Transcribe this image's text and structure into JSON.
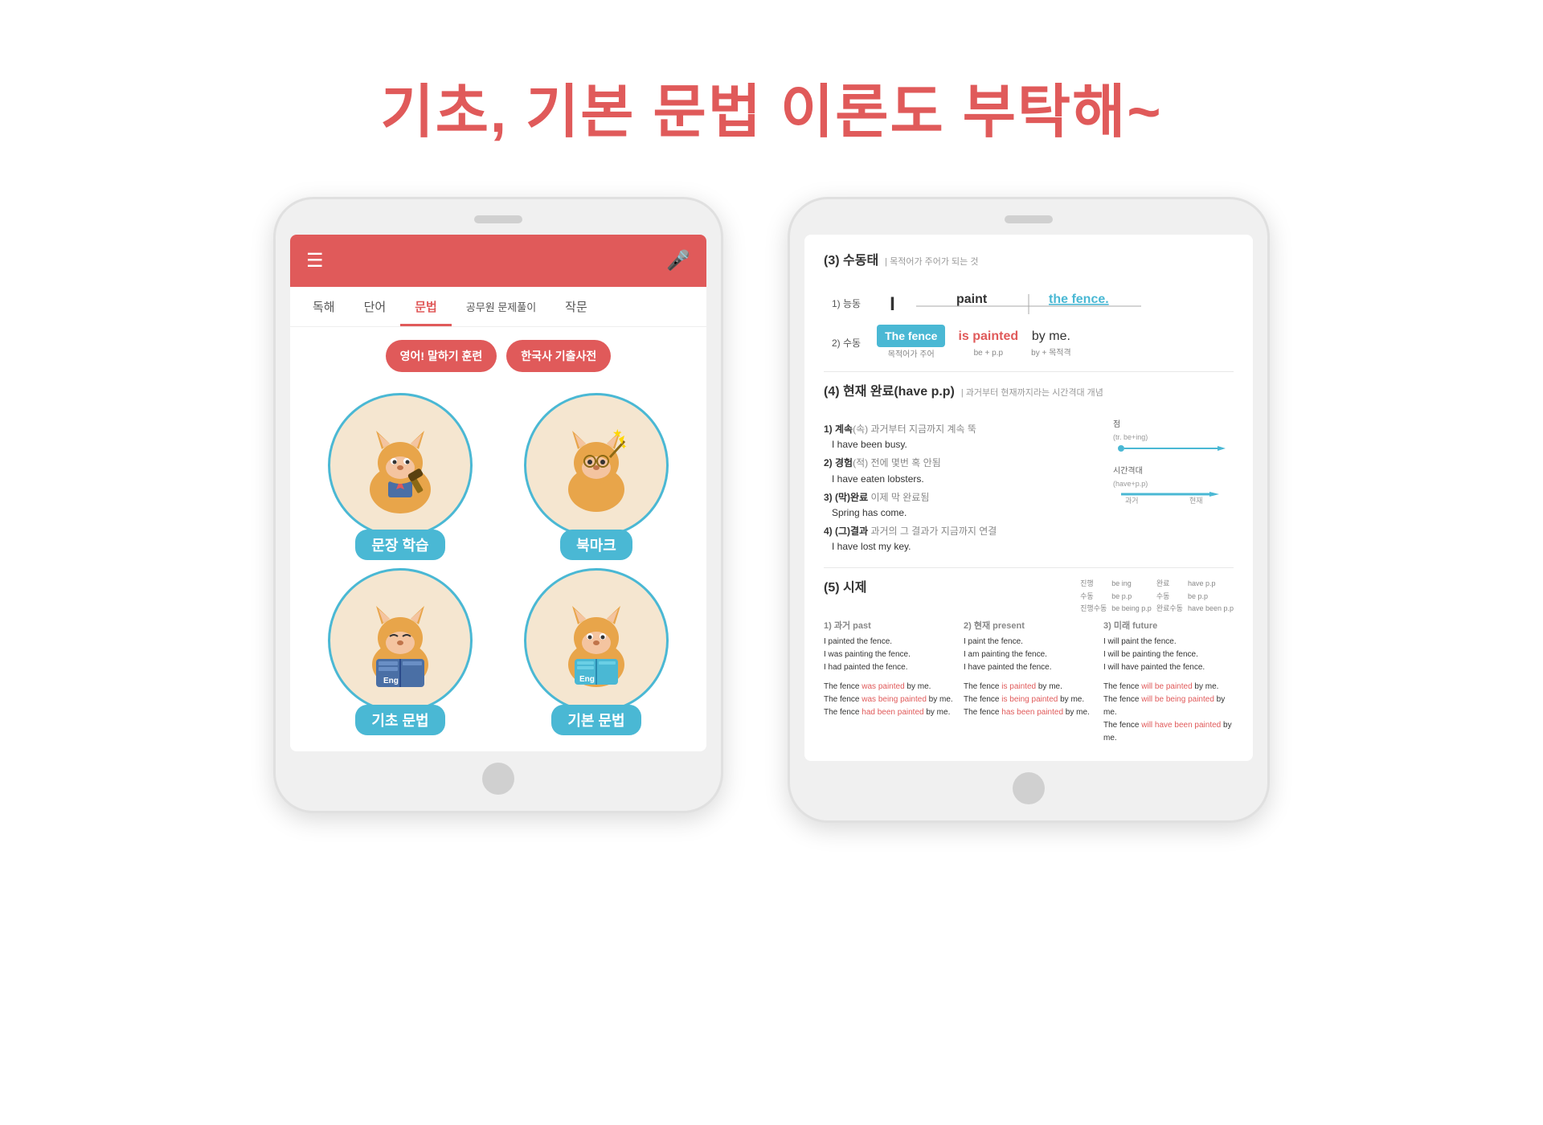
{
  "title": "기초, 기본 문법 이론도 부탁해~",
  "left_phone": {
    "nav_items": [
      "독해",
      "단어",
      "문법",
      "공무원 문제풀이",
      "작문"
    ],
    "active_nav": "문법",
    "buttons": [
      "영어! 말하기 훈련",
      "한국사 기출사전"
    ],
    "grid_items": [
      {
        "label": "문장 학습"
      },
      {
        "label": "북마크"
      },
      {
        "label": "기초 문법"
      },
      {
        "label": "기본 문법"
      }
    ]
  },
  "right_phone": {
    "section3": {
      "title": "(3) 수동태",
      "subtitle": "| 목적어가 주어가 되는 것",
      "row1_label": "1) 능동",
      "row1_words": [
        "I",
        "paint",
        "the fence."
      ],
      "row2_label": "2) 수동",
      "row2_words": [
        "The fence",
        "is painted",
        "by me."
      ],
      "row2_sublabels": [
        "목적어가 주어",
        "be + p.p",
        "by + 목적격"
      ]
    },
    "section4": {
      "title": "(4) 현재 완료(have p.p)",
      "subtitle": "| 과거부터 현재까지라는 시간격대 개념",
      "items": [
        {
          "label": "1) 계속(속)",
          "sub": "과거부터 지금까지 계속 뚝",
          "example": "I have been busy."
        },
        {
          "label": "2) 경험(적)",
          "sub": "전에 몇번 혹 안됨",
          "example": "I have eaten lobsters."
        },
        {
          "label": "3) (막)완료",
          "sub": "이제 막 완료됨",
          "example": "Spring has come."
        },
        {
          "label": "4) (그)결과",
          "sub": "과거의 그 결과가 지금까지 연결",
          "example": "I have lost my key."
        }
      ]
    },
    "section5": {
      "title": "(5) 시제",
      "tense_table": {
        "headers": [
          "진행",
          "be ing",
          "완료",
          "have p.p"
        ],
        "rows": [
          [
            "수동",
            "be",
            "p.p",
            "수동",
            "be",
            "p.p"
          ],
          [
            "진행수동",
            "be being p.p",
            "완료수동",
            "have been p.p"
          ]
        ]
      },
      "conjugation": {
        "past_label": "1) 과거 past",
        "present_label": "2) 현재 present",
        "future_label": "3) 미래 future",
        "past_sentences": [
          "I painted the fence.",
          "I was painting the fence.",
          "I had painted the fence."
        ],
        "present_sentences": [
          "I paint the fence.",
          "I am painting the fence.",
          "I have painted the fence."
        ],
        "future_sentences": [
          "I will paint the fence.",
          "I will be painting the fence.",
          "I will have painted the fence."
        ],
        "passive_past": [
          "The fence was painted by me.",
          "The fence was being painted by me.",
          "The fence had been painted by me."
        ],
        "passive_present": [
          "The fence is painted by me.",
          "The fence is being painted by me.",
          "The fence has been painted by me."
        ],
        "passive_future": [
          "The fence will be painted by me.",
          "The fence will be being painted by me.",
          "The fence will have been painted by me."
        ]
      }
    }
  }
}
